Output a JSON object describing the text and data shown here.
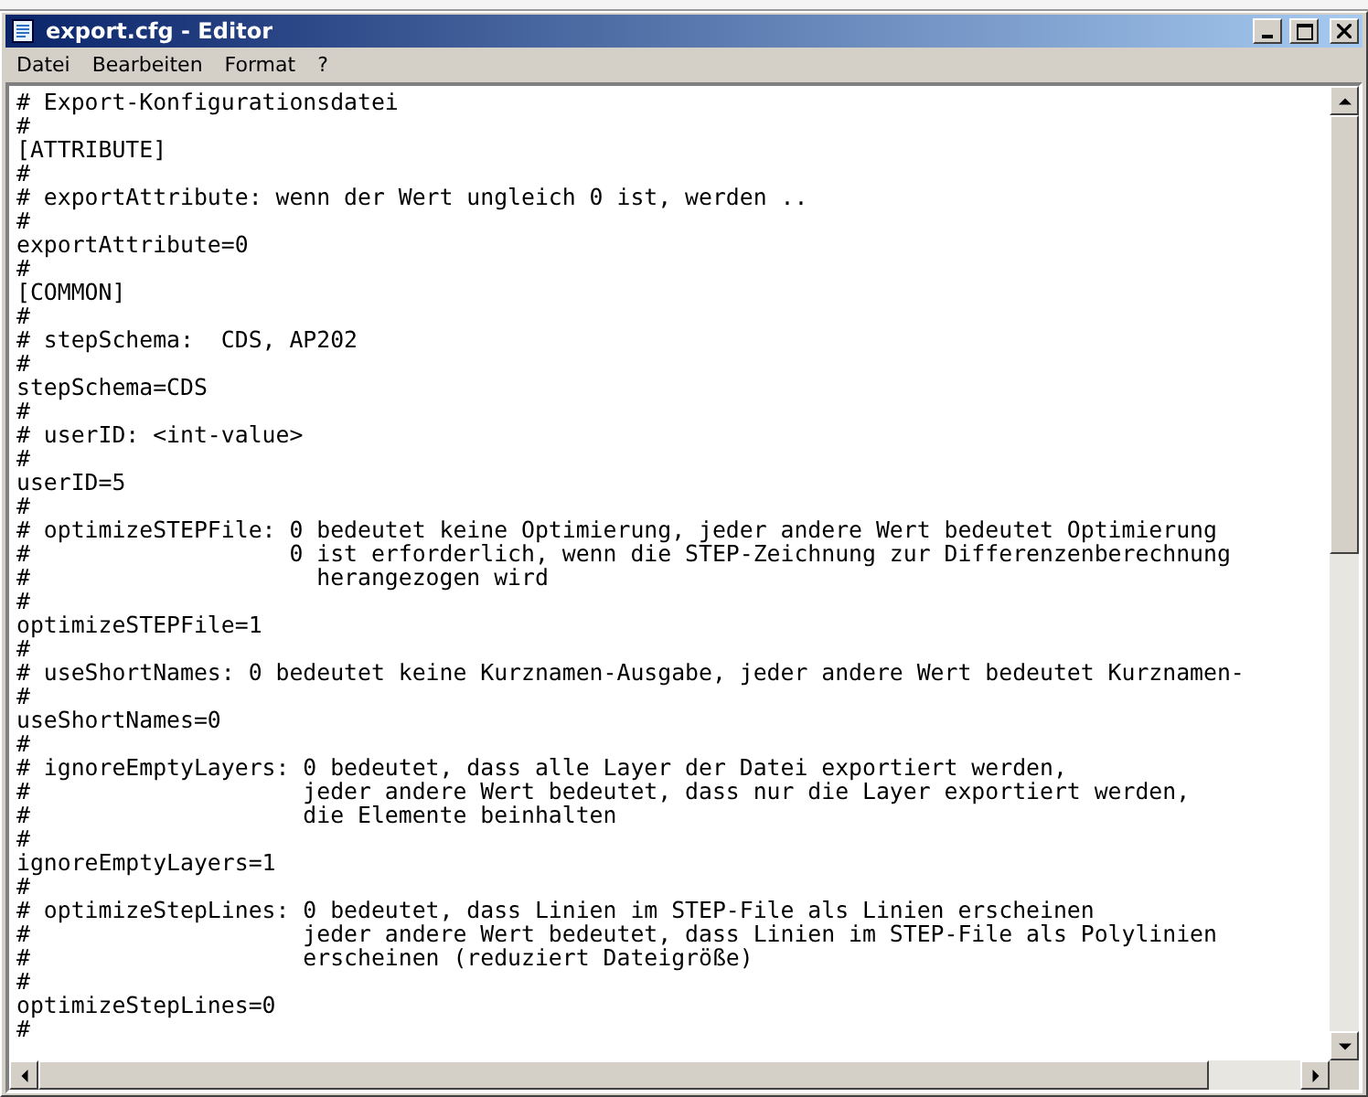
{
  "window": {
    "title": "export.cfg - Editor"
  },
  "menu": [
    {
      "label": "Datei"
    },
    {
      "label": "Bearbeiten"
    },
    {
      "label": "Format"
    },
    {
      "label": "?"
    }
  ],
  "lines": [
    "# Export-Konfigurationsdatei",
    "#",
    "[ATTRIBUTE]",
    "#",
    "# exportAttribute: wenn der Wert ungleich 0 ist, werden ..",
    "#",
    "exportAttribute=0",
    "#",
    "[COMMON]",
    "#",
    "# stepSchema:  CDS, AP202",
    "#",
    "stepSchema=CDS",
    "#",
    "# userID: <int-value>",
    "#",
    "userID=5",
    "#",
    "# optimizeSTEPFile: 0 bedeutet keine Optimierung, jeder andere Wert bedeutet Optimierung",
    "#                   0 ist erforderlich, wenn die STEP-Zeichnung zur Differenzenberechnung",
    "#                     herangezogen wird",
    "#",
    "optimizeSTEPFile=1",
    "#",
    "# useShortNames: 0 bedeutet keine Kurznamen-Ausgabe, jeder andere Wert bedeutet Kurznamen-",
    "#",
    "useShortNames=0",
    "#",
    "# ignoreEmptyLayers: 0 bedeutet, dass alle Layer der Datei exportiert werden,",
    "#                    jeder andere Wert bedeutet, dass nur die Layer exportiert werden,",
    "#                    die Elemente beinhalten",
    "#",
    "ignoreEmptyLayers=1",
    "#",
    "# optimizeStepLines: 0 bedeutet, dass Linien im STEP-File als Linien erscheinen",
    "#                    jeder andere Wert bedeutet, dass Linien im STEP-File als Polylinien",
    "#                    erscheinen (reduziert Dateigröße)",
    "#",
    "optimizeStepLines=0",
    "#"
  ]
}
